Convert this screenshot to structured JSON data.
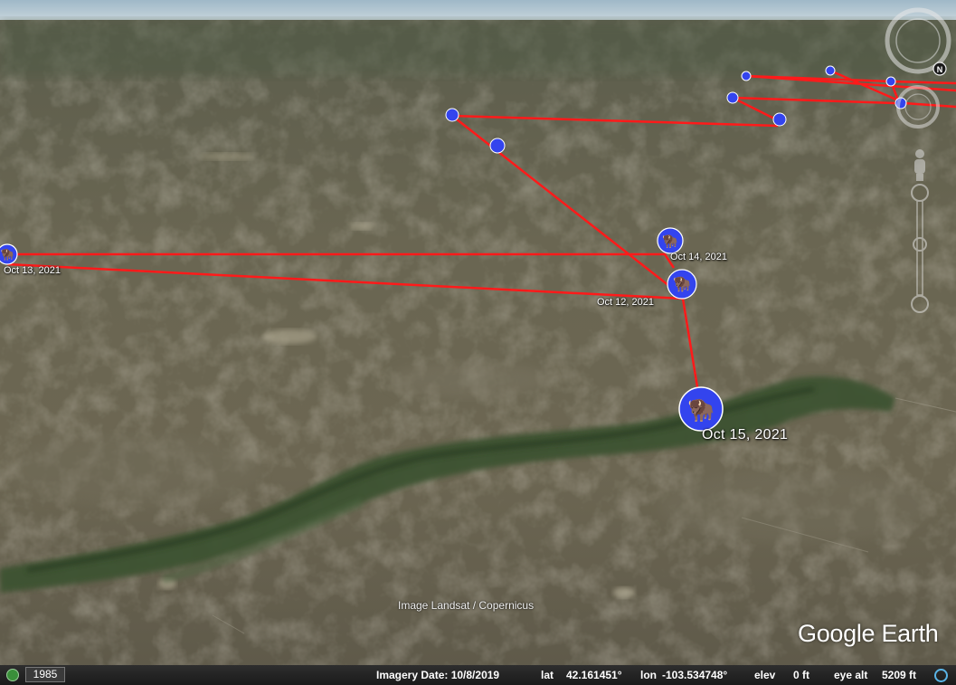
{
  "map": {
    "track_color": "#ff1a1a",
    "marker_color": "#3344ee",
    "marker_icon": "bison-icon",
    "labels": {
      "oct13": "Oct 13, 2021",
      "oct14": "Oct 14, 2021",
      "oct12": "Oct 12, 2021",
      "oct15": "Oct 15, 2021"
    }
  },
  "attribution": "Image Landsat / Copernicus",
  "logo": "Google Earth",
  "statusbar": {
    "year": "1985",
    "imagery_date": "Imagery Date: 10/8/2019",
    "lat_label": "lat",
    "lat_value": "42.161451°",
    "lon_label": "lon",
    "lon_value": "-103.534748°",
    "elev_label": "elev",
    "elev_value": "0 ft",
    "eye_alt_label": "eye alt",
    "eye_alt_value": "5209 ft"
  },
  "navigation": {
    "compass_icon": "compass-ring-icon",
    "north_icon": "north-arrow-icon",
    "look_icon": "look-joystick-icon",
    "pegman_icon": "street-view-pegman-icon",
    "zoom_icon": "zoom-slider-icon"
  }
}
